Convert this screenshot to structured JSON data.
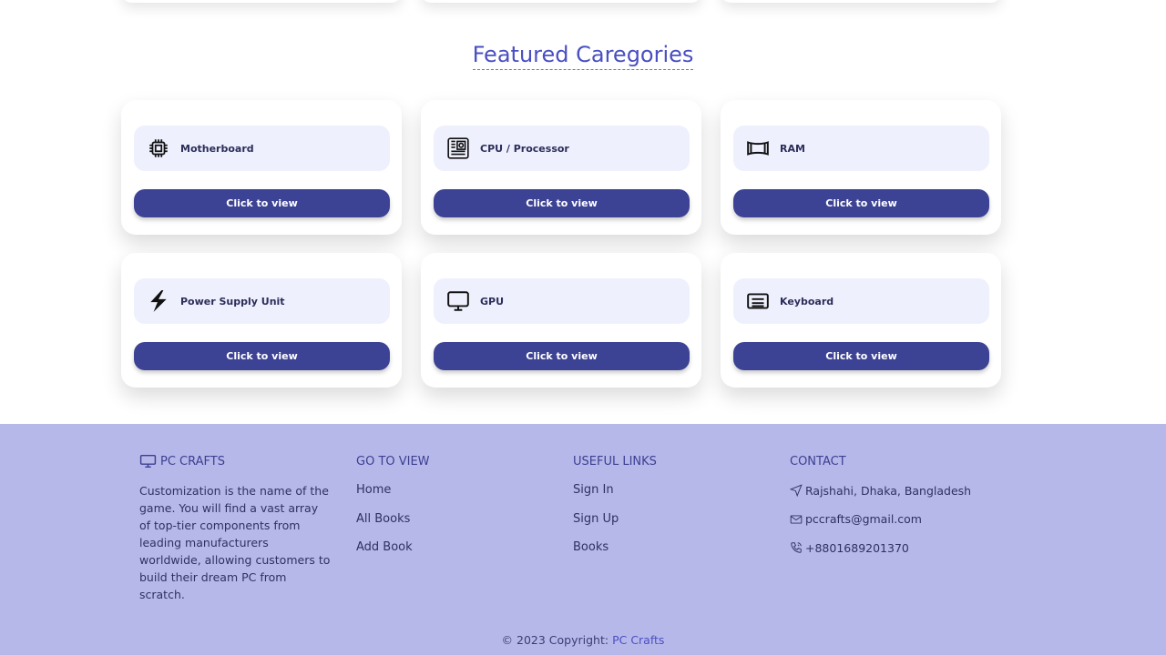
{
  "section": {
    "title": "Featured Caregories"
  },
  "categories": [
    {
      "label": "Motherboard",
      "icon": "chip-icon",
      "button": "Click to view"
    },
    {
      "label": "CPU / Processor",
      "icon": "cpu-icon",
      "button": "Click to view"
    },
    {
      "label": "RAM",
      "icon": "ram-icon",
      "button": "Click to view"
    },
    {
      "label": "Power Supply Unit",
      "icon": "lightning-icon",
      "button": "Click to view"
    },
    {
      "label": "GPU",
      "icon": "monitor-icon",
      "button": "Click to view"
    },
    {
      "label": "Keyboard",
      "icon": "keyboard-icon",
      "button": "Click to view"
    }
  ],
  "footer": {
    "brand": {
      "title": "PC CRAFTS",
      "icon": "monitor-icon",
      "description": "Customization is the name of the game. You will find a vast array of top-tier components from leading manufacturers worldwide, allowing customers to build their dream PC from scratch."
    },
    "go_to_view": {
      "title": "GO TO VIEW",
      "links": [
        "Home",
        "All Books",
        "Add Book"
      ]
    },
    "useful_links": {
      "title": "USEFUL LINKS",
      "links": [
        "Sign In",
        "Sign Up",
        "Books"
      ]
    },
    "contact": {
      "title": "CONTACT",
      "address": "Rajshahi, Dhaka, Bangladesh",
      "email": "pccrafts@gmail.com",
      "phone": "+8801689201370"
    },
    "copyright_prefix": "© 2023 Copyright:",
    "copyright_link": "PC Crafts"
  },
  "colors": {
    "accent": "#4a4fc2",
    "button": "#3c4294",
    "footer_bg": "#b7b8ea",
    "card_head_bg": "#eef0fd"
  }
}
